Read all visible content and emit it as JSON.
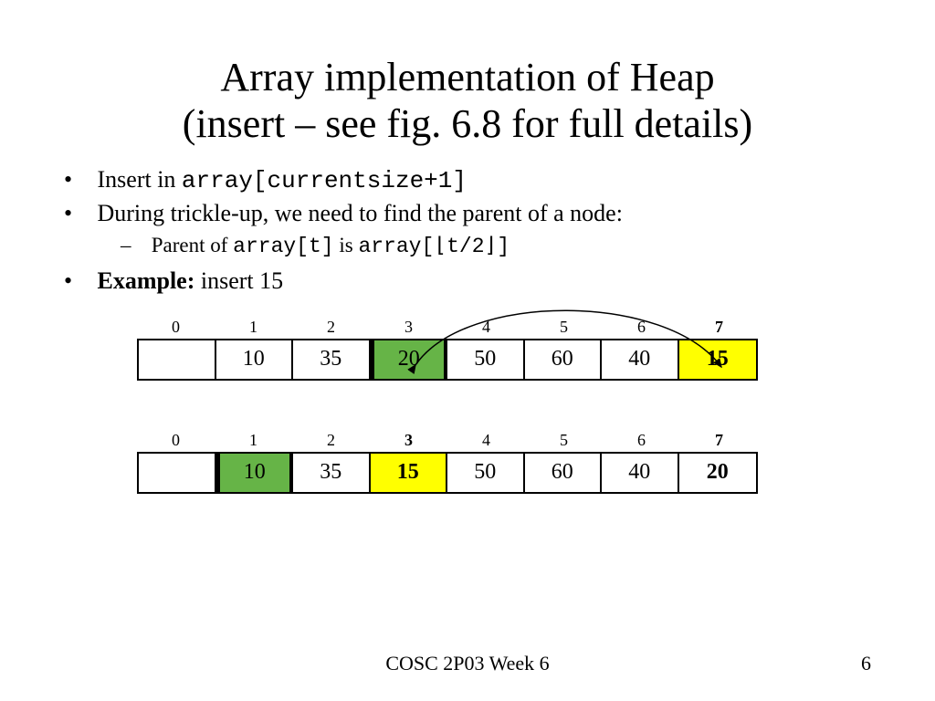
{
  "title_line1": "Array implementation of Heap",
  "title_line2": "(insert – see fig. 6.8 for full details)",
  "bullets": {
    "b1_prefix": "Insert in ",
    "b1_code": "array[currentsize+1]",
    "b2": "During trickle-up, we need to find the parent of a node:",
    "b2_sub_prefix": "Parent of ",
    "b2_sub_code1": "array[t]",
    "b2_sub_mid": " is ",
    "b2_sub_code2": "array[⌊t/2⌋]",
    "b3_bold": "Example:",
    "b3_rest": " insert 15"
  },
  "array1": {
    "indices": [
      "0",
      "1",
      "2",
      "3",
      "4",
      "5",
      "6",
      "7"
    ],
    "index_bold": [
      false,
      false,
      false,
      false,
      false,
      false,
      false,
      true
    ],
    "values": [
      "",
      "10",
      "35",
      "20",
      "50",
      "60",
      "40",
      "15"
    ],
    "value_bold": [
      false,
      false,
      false,
      false,
      false,
      false,
      false,
      true
    ],
    "green_idx": 3,
    "yellow_idx": 7,
    "thick_around_idx": 3
  },
  "array2": {
    "indices": [
      "0",
      "1",
      "2",
      "3",
      "4",
      "5",
      "6",
      "7"
    ],
    "index_bold": [
      false,
      false,
      false,
      true,
      false,
      false,
      false,
      true
    ],
    "values": [
      "",
      "10",
      "35",
      "15",
      "50",
      "60",
      "40",
      "20"
    ],
    "value_bold": [
      false,
      false,
      false,
      true,
      false,
      false,
      false,
      true
    ],
    "green_idx": 1,
    "yellow_idx": 3,
    "thick_around_idx": 1
  },
  "footer": {
    "center": "COSC 2P03 Week 6",
    "page": "6"
  }
}
